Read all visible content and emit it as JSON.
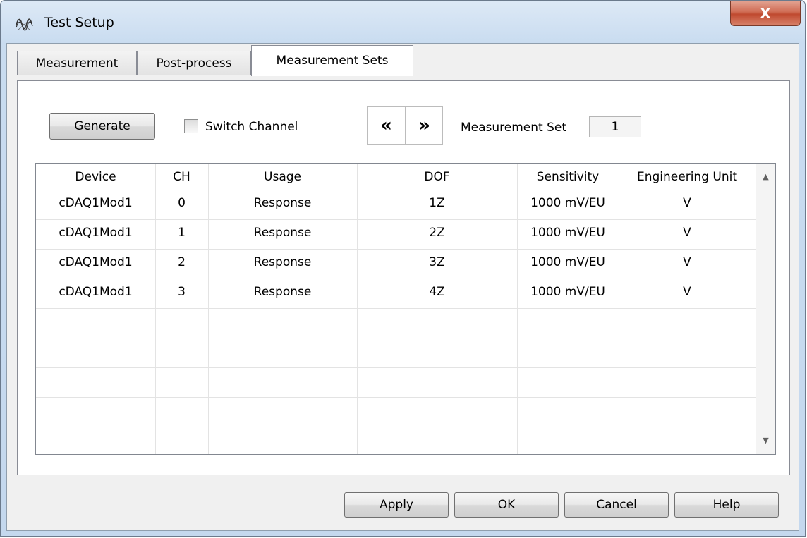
{
  "window": {
    "title": "Test Setup",
    "close_symbol": "X"
  },
  "tabs": [
    {
      "label": "Measurement",
      "active": false
    },
    {
      "label": "Post-process",
      "active": false
    },
    {
      "label": "Measurement Sets",
      "active": true
    }
  ],
  "toolbar": {
    "generate_label": "Generate",
    "switch_channel_label": "Switch Channel",
    "switch_channel_checked": false,
    "prev_symbol": "«",
    "next_symbol": "»",
    "measurement_set_label": "Measurement Set",
    "measurement_set_value": "1"
  },
  "table": {
    "columns": [
      "Device",
      "CH",
      "Usage",
      "DOF",
      "Sensitivity",
      "Engineering Unit"
    ],
    "rows": [
      [
        "cDAQ1Mod1",
        "0",
        "Response",
        "1Z",
        "1000 mV/EU",
        "V"
      ],
      [
        "cDAQ1Mod1",
        "1",
        "Response",
        "2Z",
        "1000 mV/EU",
        "V"
      ],
      [
        "cDAQ1Mod1",
        "2",
        "Response",
        "3Z",
        "1000 mV/EU",
        "V"
      ],
      [
        "cDAQ1Mod1",
        "3",
        "Response",
        "4Z",
        "1000 mV/EU",
        "V"
      ]
    ],
    "scroll_up_symbol": "▲",
    "scroll_down_symbol": "▼"
  },
  "footer": {
    "apply_label": "Apply",
    "ok_label": "OK",
    "cancel_label": "Cancel",
    "help_label": "Help"
  },
  "icons": {
    "app": "signal-analysis-icon",
    "close": "close-icon",
    "checkbox": "checkbox-icon",
    "prev": "double-chevron-left-icon",
    "next": "double-chevron-right-icon"
  }
}
